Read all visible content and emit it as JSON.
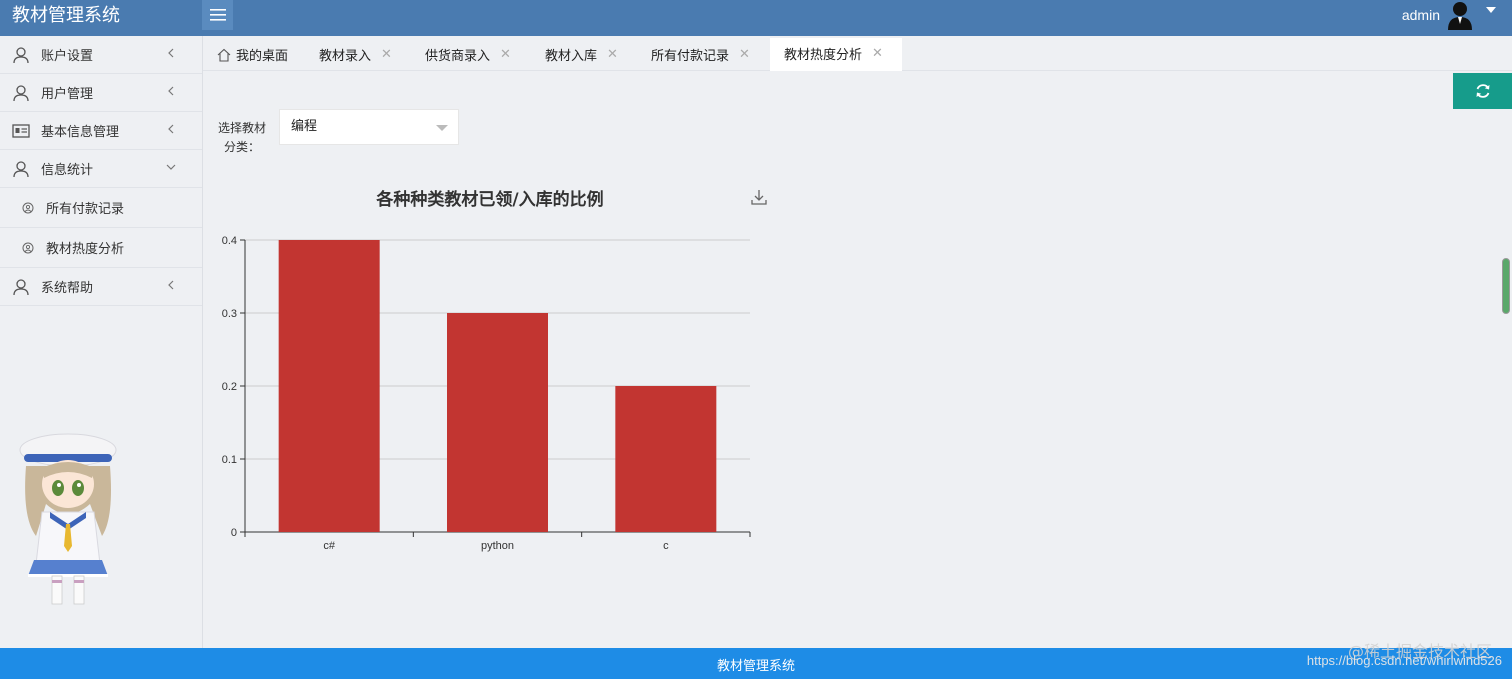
{
  "app": {
    "title": "教材管理系统"
  },
  "user": {
    "name": "admin"
  },
  "sidebar": {
    "items": [
      {
        "label": "账户设置"
      },
      {
        "label": "用户管理"
      },
      {
        "label": "基本信息管理"
      },
      {
        "label": "信息统计"
      },
      {
        "label": "系统帮助"
      }
    ],
    "sub_items": [
      {
        "label": "所有付款记录"
      },
      {
        "label": "教材热度分析"
      }
    ]
  },
  "tabs": [
    {
      "label": "我的桌面"
    },
    {
      "label": "教材录入"
    },
    {
      "label": "供货商录入"
    },
    {
      "label": "教材入库"
    },
    {
      "label": "所有付款记录"
    },
    {
      "label": "教材热度分析",
      "active": true
    }
  ],
  "filter": {
    "label_line1": "选择教材",
    "label_line2": "分类：",
    "selected": "编程"
  },
  "chart_data": {
    "type": "bar",
    "title": "各种种类教材已领/入库的比例",
    "categories": [
      "c#",
      "python",
      "c"
    ],
    "values": [
      0.4,
      0.3,
      0.2
    ],
    "ylim": [
      0,
      0.4
    ],
    "yticks": [
      "0",
      "0.1",
      "0.2",
      "0.3",
      "0.4"
    ],
    "bar_color": "#c23531",
    "grid": true
  },
  "footer": {
    "text": "教材管理系统"
  },
  "watermark": {
    "line1": "@稀土掘金技术社区",
    "line2": "https://blog.csdn.net/whirlwind526"
  },
  "colors": {
    "header": "#4a7bb0",
    "footer": "#1e8ce6",
    "refresh": "#169c8b"
  }
}
